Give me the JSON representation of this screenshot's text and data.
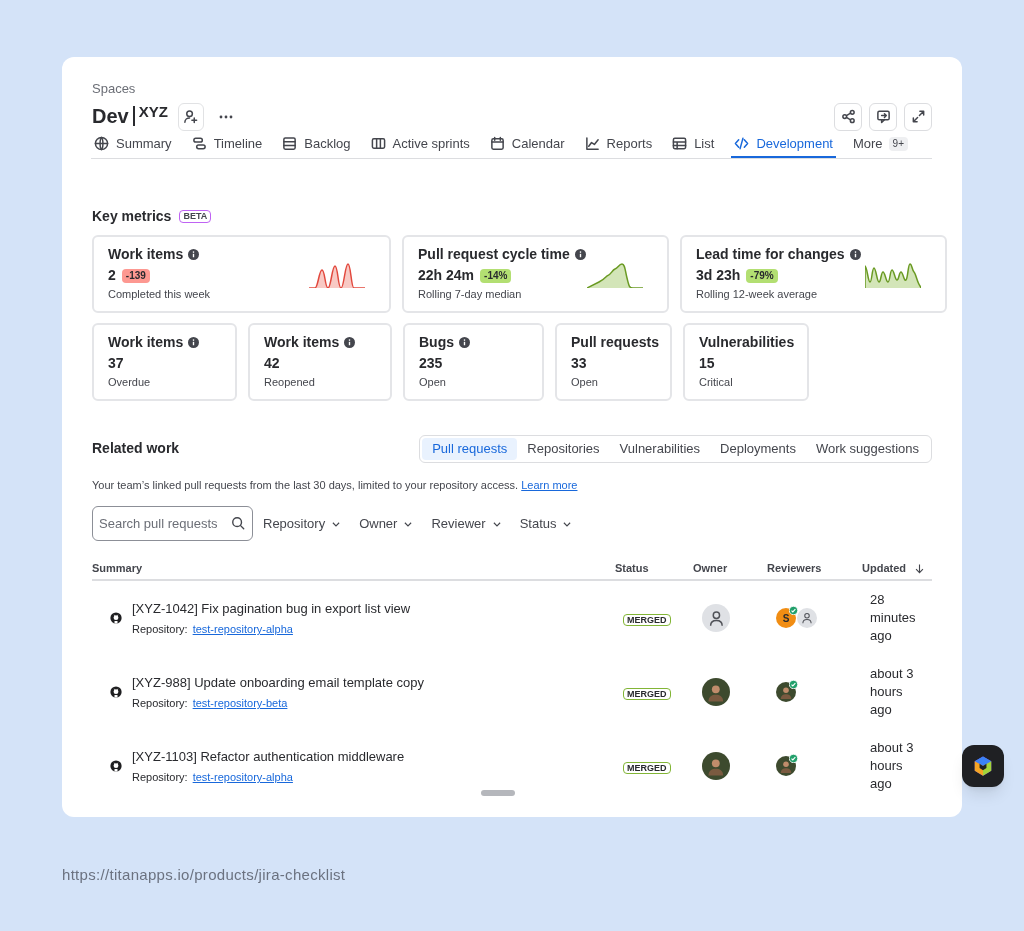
{
  "breadcrumb": "Spaces",
  "title": {
    "name": "Dev",
    "suffix": "XYZ"
  },
  "tabs": [
    {
      "label": "Summary",
      "selected": false
    },
    {
      "label": "Timeline",
      "selected": false
    },
    {
      "label": "Backlog",
      "selected": false
    },
    {
      "label": "Active sprints",
      "selected": false
    },
    {
      "label": "Calendar",
      "selected": false
    },
    {
      "label": "Reports",
      "selected": false
    },
    {
      "label": "List",
      "selected": false
    },
    {
      "label": "Development",
      "selected": true
    }
  ],
  "more": {
    "label": "More",
    "badge": "9+"
  },
  "key_metrics": {
    "title": "Key metrics",
    "badge": "BETA",
    "cards": [
      {
        "title": "Work items",
        "info": true,
        "value": "2",
        "delta": {
          "text": "-139",
          "color": "#fd9891"
        },
        "caption": "Completed this week"
      },
      {
        "title": "Pull request cycle time",
        "info": true,
        "value": "22h 24m",
        "delta": {
          "text": "-14%",
          "color": "#b3df72"
        },
        "caption": "Rolling 7-day median"
      },
      {
        "title": "Lead time for changes",
        "info": true,
        "value": "3d 23h",
        "delta": {
          "text": "-79%",
          "color": "#b3df72"
        },
        "caption": "Rolling 12-week average"
      },
      {
        "title": "Work items",
        "info": true,
        "value": "37",
        "caption": "Overdue"
      },
      {
        "title": "Work items",
        "info": true,
        "value": "42",
        "caption": "Reopened"
      },
      {
        "title": "Bugs",
        "info": true,
        "value": "235",
        "caption": "Open"
      },
      {
        "title": "Pull requests",
        "info": false,
        "value": "33",
        "caption": "Open"
      },
      {
        "title": "Vulnerabilities",
        "info": false,
        "value": "15",
        "caption": "Critical"
      }
    ]
  },
  "related_work": {
    "title": "Related work",
    "tabs": [
      {
        "label": "Pull requests",
        "selected": true
      },
      {
        "label": "Repositories",
        "selected": false
      },
      {
        "label": "Vulnerabilities",
        "selected": false
      },
      {
        "label": "Deployments",
        "selected": false
      },
      {
        "label": "Work suggestions",
        "selected": false
      }
    ],
    "description": "Your team’s linked pull requests from the last 30 days, limited to your repository access.",
    "link": "Learn more",
    "search": {
      "placeholder": "Search pull requests"
    },
    "filters": [
      "Repository",
      "Owner",
      "Reviewer",
      "Status"
    ],
    "columns": [
      {
        "label": "Summary"
      },
      {
        "label": "Status"
      },
      {
        "label": "Owner"
      },
      {
        "label": "Reviewers"
      },
      {
        "label": "Updated",
        "sorted": true
      }
    ],
    "rows": [
      {
        "summary": "[XYZ-1042] Fix pagination bug in export list view",
        "repo_label": "Repository:",
        "repo": "test-repository-alpha",
        "status": "MERGED",
        "owner": {
          "kind": "placeholder"
        },
        "reviewers": [
          {
            "kind": "initial",
            "initial": "S",
            "approved": true
          },
          {
            "kind": "placeholder",
            "approved": false
          }
        ],
        "updated": "28 minutes ago"
      },
      {
        "summary": "[XYZ-988] Update onboarding email template copy",
        "repo_label": "Repository:",
        "repo": "test-repository-beta",
        "status": "MERGED",
        "owner": {
          "kind": "photo"
        },
        "reviewers": [
          {
            "kind": "photo",
            "approved": true
          }
        ],
        "updated": "about 3 hours ago"
      },
      {
        "summary": "[XYZ-1103] Refactor authentication middleware",
        "repo_label": "Repository:",
        "repo": "test-repository-alpha",
        "status": "MERGED",
        "owner": {
          "kind": "photo"
        },
        "reviewers": [
          {
            "kind": "photo",
            "approved": true
          }
        ],
        "updated": "about 3 hours ago"
      }
    ]
  },
  "footer_url": "https://titanapps.io/products/jira-checklist"
}
